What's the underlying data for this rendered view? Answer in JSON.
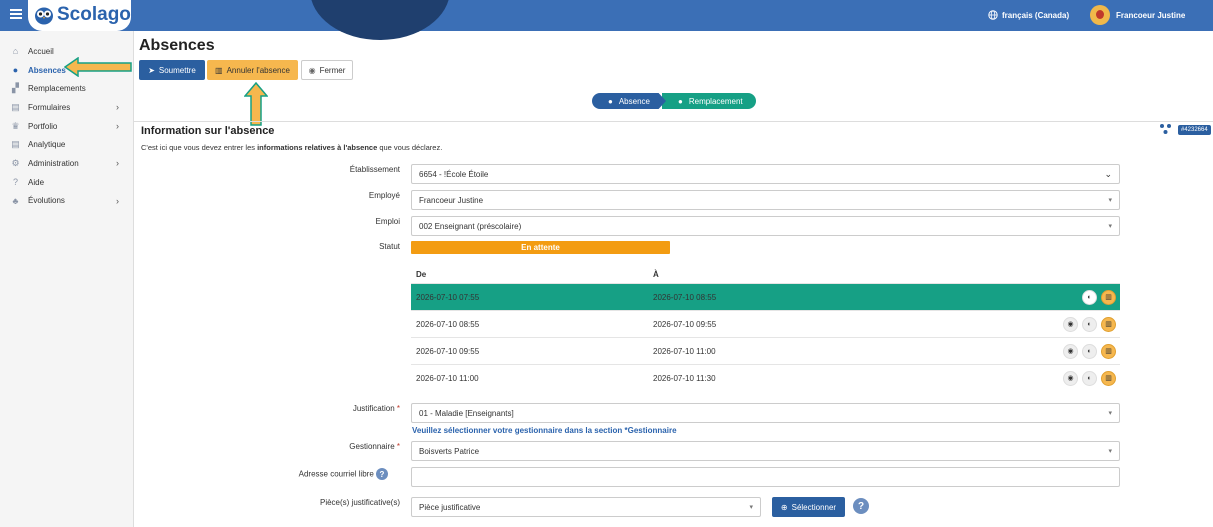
{
  "app": {
    "logo": "Scolago"
  },
  "header": {
    "language": "français (Canada)",
    "user_name": "Francoeur Justine"
  },
  "sidebar": {
    "items": [
      {
        "label": "Accueil",
        "icon": "home-icon"
      },
      {
        "label": "Absences",
        "icon": "user-clock-icon",
        "active": true
      },
      {
        "label": "Remplacements",
        "icon": "chart-icon"
      },
      {
        "label": "Formulaires",
        "icon": "document-icon",
        "chevron": true
      },
      {
        "label": "Portfolio",
        "icon": "trophy-icon",
        "chevron": true
      },
      {
        "label": "Analytique",
        "icon": "document-icon"
      },
      {
        "label": "Administration",
        "icon": "gear-icon",
        "chevron": true
      },
      {
        "label": "Aide",
        "icon": "question-icon"
      },
      {
        "label": "Évolutions",
        "icon": "plant-icon",
        "chevron": true
      }
    ]
  },
  "page": {
    "title": "Absences",
    "toolbar": {
      "submit": "Soumettre",
      "cancel": "Annuler l'absence",
      "close": "Fermer"
    },
    "steps": {
      "step1": "Absence",
      "step2": "Remplacement"
    },
    "section_title": "Information sur l'absence",
    "desc_pre": "C'est ici que vous devez entrer les ",
    "desc_bold": "informations relatives à l'absence",
    "desc_post": " que vous déclarez.",
    "id_badge": "#4232664"
  },
  "form": {
    "etablissement": {
      "label": "Établissement",
      "value": "6654 - !École Étoile"
    },
    "employe": {
      "label": "Employé",
      "value": "Francoeur Justine"
    },
    "emploi": {
      "label": "Emploi",
      "value": "002 Enseignant (préscolaire)"
    },
    "statut": {
      "label": "Statut",
      "value": "En attente"
    },
    "periods": {
      "headers": {
        "from": "De",
        "to": "À"
      },
      "rows": [
        {
          "from": "2026-07-10 07:55",
          "to": "2026-07-10 08:55"
        },
        {
          "from": "2026-07-10 08:55",
          "to": "2026-07-10 09:55"
        },
        {
          "from": "2026-07-10 09:55",
          "to": "2026-07-10 11:00"
        },
        {
          "from": "2026-07-10 11:00",
          "to": "2026-07-10 11:30"
        }
      ]
    },
    "justification": {
      "label": "Justification",
      "required": "*",
      "value": "01 - Maladie [Enseignants]"
    },
    "gestionnaire_help": "Veuillez sélectionner votre gestionnaire dans la section *Gestionnaire",
    "gestionnaire": {
      "label": "Gestionnaire",
      "required": "*",
      "value": "Boisverts Patrice"
    },
    "adresse": {
      "label": "Adresse courriel libre",
      "value": ""
    },
    "pieces": {
      "label": "Pièce(s) justificative(s)",
      "value": "Pièce justificative",
      "button": "Sélectionner"
    }
  },
  "colors": {
    "primary": "#2b5fa0",
    "accent": "#16a085",
    "warning": "#f39c12",
    "cancel": "#f6b74e"
  }
}
